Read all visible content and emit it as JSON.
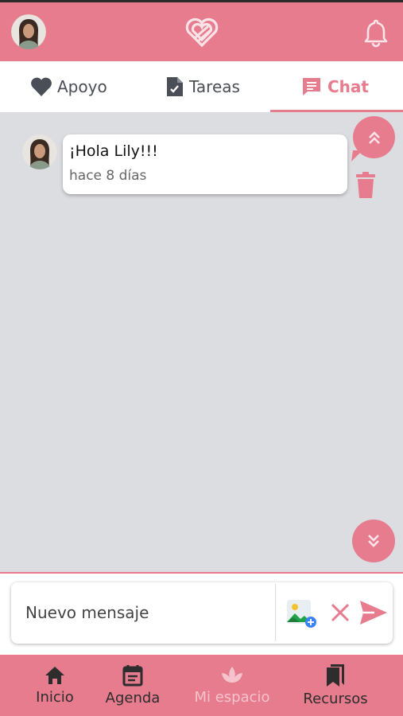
{
  "colors": {
    "brand": "#e67c8e",
    "background": "#dcdde0",
    "text": "#4a4e57",
    "active_nav": "#f6c3cc"
  },
  "header": {
    "avatar_icon": "user-avatar",
    "logo_icon": "heart-logo-icon",
    "notification_icon": "bell-icon"
  },
  "tabs": [
    {
      "label": "Apoyo",
      "icon": "heart-icon",
      "active": false
    },
    {
      "label": "Tareas",
      "icon": "file-check-icon",
      "active": false
    },
    {
      "label": "Chat",
      "icon": "chat-icon",
      "active": true
    }
  ],
  "chat": {
    "messages": [
      {
        "text": "¡Hola Lily!!!",
        "time": "hace 8 días"
      }
    ]
  },
  "composer": {
    "placeholder": "Nuevo mensaje"
  },
  "bottom_nav": [
    {
      "label": "Inicio",
      "icon": "home-icon",
      "active": false
    },
    {
      "label": "Agenda",
      "icon": "calendar-icon",
      "active": false
    },
    {
      "label": "Mi espacio",
      "icon": "lotus-icon",
      "active": true
    },
    {
      "label": "Recursos",
      "icon": "bookmarks-icon",
      "active": false
    }
  ]
}
